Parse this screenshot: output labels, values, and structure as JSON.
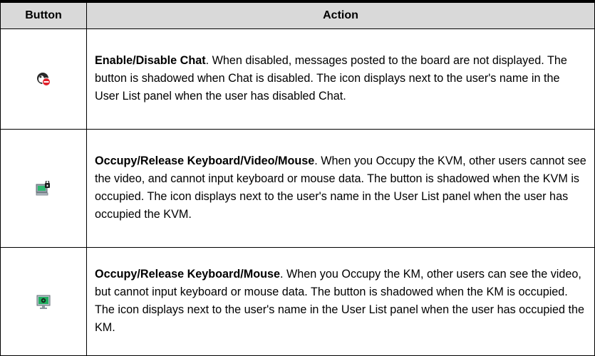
{
  "table": {
    "headers": {
      "button": "Button",
      "action": "Action"
    },
    "rows": [
      {
        "icon": "chat-disabled-icon",
        "title": "Enable/Disable Chat",
        "description": ". When disabled, messages posted to the board are not displayed. The button is shadowed when Chat is disabled. The icon displays next to the user's name in the User List panel when the user has disabled Chat."
      },
      {
        "icon": "occupy-kvm-icon",
        "title": "Occupy/Release Keyboard/Video/Mouse",
        "description": ". When you Occupy the KVM, other users cannot see the video, and cannot input keyboard or mouse data. The button is shadowed when the KVM is occupied. The icon displays next to the user's name in the User List panel when the user has occupied the KVM."
      },
      {
        "icon": "occupy-km-icon",
        "title": "Occupy/Release Keyboard/Mouse",
        "description": ". When you Occupy the KM, other users can see the video, but cannot input keyboard or mouse data. The button is shadowed when the KM is occupied. The icon displays next to the user's name in the User List panel when the user has occupied the KM."
      }
    ]
  },
  "colors": {
    "header_bg": "#d9d9d9",
    "border": "#000000",
    "chat_icon_red": "#e0202a",
    "monitor_green": "#1fae5f"
  }
}
